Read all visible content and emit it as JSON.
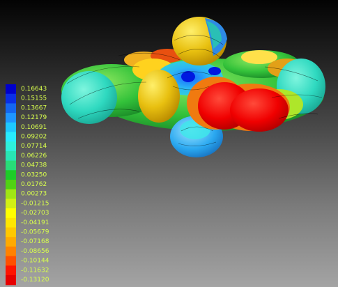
{
  "legend": {
    "entries": [
      {
        "label": "0.16643",
        "color": "#0000cc"
      },
      {
        "label": "0.15155",
        "color": "#0a2ee6"
      },
      {
        "label": "0.13667",
        "color": "#1466f0"
      },
      {
        "label": "0.12179",
        "color": "#1e96ff"
      },
      {
        "label": "0.10691",
        "color": "#1ec8ff"
      },
      {
        "label": "0.09202",
        "color": "#28ebff"
      },
      {
        "label": "0.07714",
        "color": "#2ef0dc"
      },
      {
        "label": "0.06226",
        "color": "#28e6b4"
      },
      {
        "label": "0.04738",
        "color": "#28dc78"
      },
      {
        "label": "0.03250",
        "color": "#1ecc28"
      },
      {
        "label": "0.01762",
        "color": "#50d214"
      },
      {
        "label": "0.00273",
        "color": "#a0e614"
      },
      {
        "label": "-0.01215",
        "color": "#d2f014"
      },
      {
        "label": "-0.02703",
        "color": "#ffff00"
      },
      {
        "label": "-0.04191",
        "color": "#ffe600"
      },
      {
        "label": "-0.05679",
        "color": "#ffc800"
      },
      {
        "label": "-0.07168",
        "color": "#ffaa00"
      },
      {
        "label": "-0.08656",
        "color": "#ff8200"
      },
      {
        "label": "-0.10144",
        "color": "#ff5000"
      },
      {
        "label": "-0.11632",
        "color": "#ff1400"
      },
      {
        "label": "-0.13120",
        "color": "#e60000"
      }
    ]
  }
}
